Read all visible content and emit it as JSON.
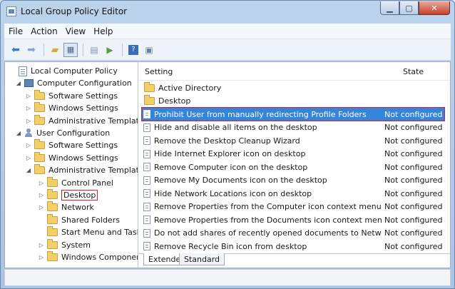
{
  "window": {
    "title": "Local Group Policy Editor"
  },
  "menu": [
    "File",
    "Action",
    "View",
    "Help"
  ],
  "toolbar": {
    "icons": [
      "back-icon",
      "forward-icon",
      "up-folder-icon",
      "show-tree-icon",
      "properties-icon",
      "export-icon",
      "help-icon",
      "filter-icon"
    ]
  },
  "tree": [
    {
      "label": "Local Computer Policy",
      "indent": 0,
      "icon": "doc",
      "twisty": ""
    },
    {
      "label": "Computer Configuration",
      "indent": 1,
      "icon": "pc",
      "twisty": "◢"
    },
    {
      "label": "Software Settings",
      "indent": 2,
      "icon": "folder",
      "twisty": "▷"
    },
    {
      "label": "Windows Settings",
      "indent": 2,
      "icon": "folder",
      "twisty": "▷"
    },
    {
      "label": "Administrative Templates",
      "indent": 2,
      "icon": "folder",
      "twisty": "▷"
    },
    {
      "label": "User Configuration",
      "indent": 1,
      "icon": "user",
      "twisty": "◢"
    },
    {
      "label": "Software Settings",
      "indent": 2,
      "icon": "folder",
      "twisty": "▷"
    },
    {
      "label": "Windows Settings",
      "indent": 2,
      "icon": "folder",
      "twisty": "▷"
    },
    {
      "label": "Administrative Templates",
      "indent": 2,
      "icon": "folder",
      "twisty": "◢"
    },
    {
      "label": "Control Panel",
      "indent": 3,
      "icon": "folder",
      "twisty": "▷"
    },
    {
      "label": "Desktop",
      "indent": 3,
      "icon": "folder",
      "twisty": "▷",
      "selected": true
    },
    {
      "label": "Network",
      "indent": 3,
      "icon": "folder",
      "twisty": "▷"
    },
    {
      "label": "Shared Folders",
      "indent": 3,
      "icon": "folder",
      "twisty": ""
    },
    {
      "label": "Start Menu and Taskbar",
      "indent": 3,
      "icon": "folder",
      "twisty": ""
    },
    {
      "label": "System",
      "indent": 3,
      "icon": "folder",
      "twisty": "▷"
    },
    {
      "label": "Windows Components",
      "indent": 3,
      "icon": "folder",
      "twisty": "▷"
    }
  ],
  "list": {
    "headers": {
      "setting": "Setting",
      "state": "State"
    },
    "rows": [
      {
        "name": "Active Directory",
        "state": "",
        "type": "folder"
      },
      {
        "name": "Desktop",
        "state": "",
        "type": "folder"
      },
      {
        "name": "Prohibit User from manually redirecting Profile Folders",
        "state": "Not configured",
        "type": "policy",
        "selected": true
      },
      {
        "name": "Hide and disable all items on the desktop",
        "state": "Not configured",
        "type": "policy"
      },
      {
        "name": "Remove the Desktop Cleanup Wizard",
        "state": "Not configured",
        "type": "policy"
      },
      {
        "name": "Hide Internet Explorer icon on desktop",
        "state": "Not configured",
        "type": "policy"
      },
      {
        "name": "Remove Computer icon on the desktop",
        "state": "Not configured",
        "type": "policy"
      },
      {
        "name": "Remove My Documents icon on the desktop",
        "state": "Not configured",
        "type": "policy"
      },
      {
        "name": "Hide Network Locations icon on desktop",
        "state": "Not configured",
        "type": "policy"
      },
      {
        "name": "Remove Properties from the Computer icon context menu",
        "state": "Not configured",
        "type": "policy"
      },
      {
        "name": "Remove Properties from the Documents icon context menu",
        "state": "Not configured",
        "type": "policy"
      },
      {
        "name": "Do not add shares of recently opened documents to Network Locations",
        "state": "Not configured",
        "type": "policy"
      },
      {
        "name": "Remove Recycle Bin icon from desktop",
        "state": "Not configured",
        "type": "policy"
      }
    ]
  },
  "tabs": [
    "Extended",
    "Standard"
  ]
}
